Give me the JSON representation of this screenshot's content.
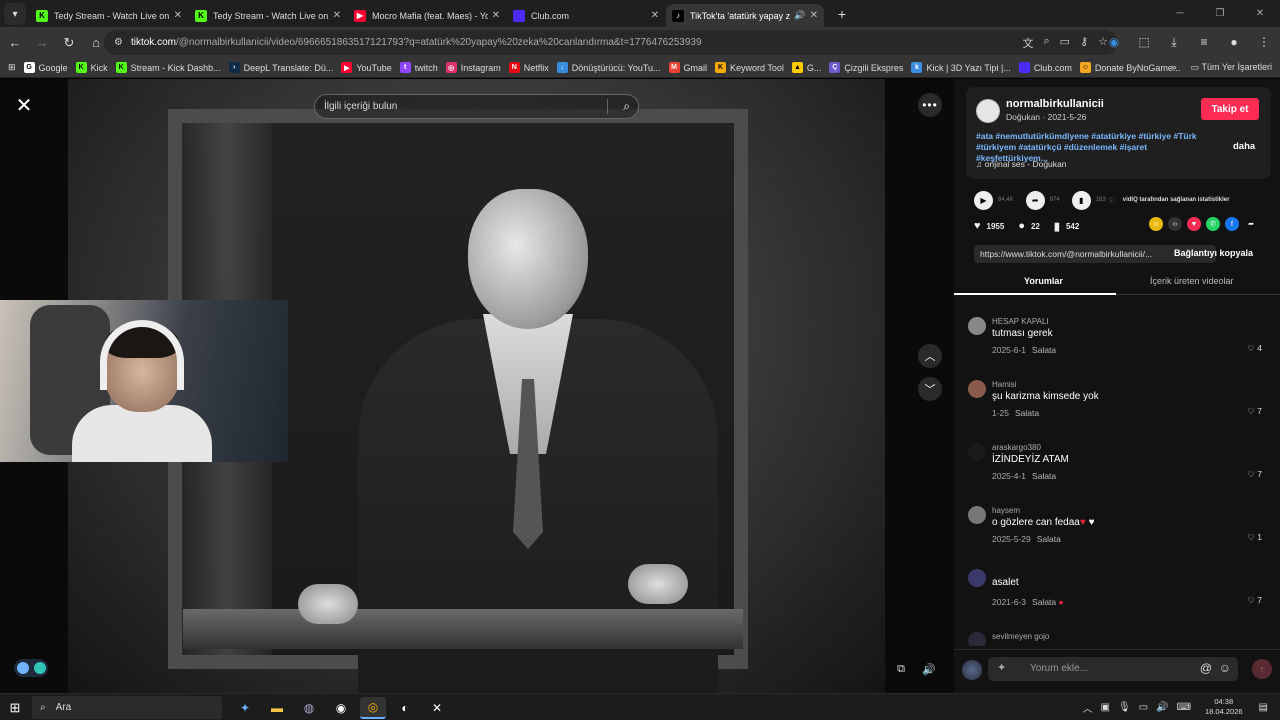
{
  "browser": {
    "tabs": [
      {
        "title": "Tedy Stream - Watch Live on Ki...",
        "favicon": "kick-icon",
        "color": "#53fc18"
      },
      {
        "title": "Tedy Stream - Watch Live on Ki...",
        "favicon": "kick-icon",
        "color": "#53fc18"
      },
      {
        "title": "Mocro Mafia (feat. Maes) - You...",
        "favicon": "youtube-icon",
        "color": "#ff0033"
      },
      {
        "title": "Club.com",
        "favicon": "club-icon",
        "color": "#4a2cff"
      },
      {
        "title": "TikTok'ta 'atatürk yapay zek...",
        "favicon": "tiktok-icon",
        "color": "#ffffff"
      }
    ],
    "url_host": "tiktok.com",
    "url_path": "/@normalbirkullanicii/video/6966651863517121793?q=atatürk%20yapay%20zeka%20canlandırma&t=1776476253939",
    "bookmarks": [
      {
        "label": "Google",
        "color": "#ffffff"
      },
      {
        "label": "Kick",
        "color": "#53fc18"
      },
      {
        "label": "Stream - Kick Dashb...",
        "color": "#53fc18"
      },
      {
        "label": "DeepL Translate: Dü...",
        "color": "#0f2b46"
      },
      {
        "label": "YouTube",
        "color": "#ff0033"
      },
      {
        "label": "twitch",
        "color": "#9146ff"
      },
      {
        "label": "Instagram",
        "color": "#e1306c"
      },
      {
        "label": "Netflix",
        "color": "#e50914"
      },
      {
        "label": "Dönüştürücü: YouTu...",
        "color": "#3a8dde"
      },
      {
        "label": "Gmail",
        "color": "#ea4335"
      },
      {
        "label": "Keyword Tool",
        "color": "#f2a900"
      },
      {
        "label": "G...",
        "color": "#ffcc00"
      },
      {
        "label": "Çizgili Ekspres",
        "color": "#6a5acd"
      },
      {
        "label": "Kick | 3D Yazı Tipi |...",
        "color": "#3a8dde"
      },
      {
        "label": "Club.com",
        "color": "#4a2cff"
      },
      {
        "label": "Donate ByNoGame...",
        "color": "#f5a623"
      }
    ],
    "bookmarks_overflow": "»",
    "all_bookmarks": "Tüm Yer İşaretleri"
  },
  "video": {
    "search_placeholder": "İlgili içeriği bulun"
  },
  "post": {
    "author": "normalbirkullanicii",
    "author_display": "Doğukan",
    "date": "2021-5-26",
    "follow_label": "Takip et",
    "hashtags": "#ata #nemutlutürkümdiyene #atatürkiye #türkiye #Türk #türkiyem #atatürkçü #düzenlemek #işaret #keşfettürkiyem...",
    "more_label": "daha",
    "music": "orijinal ses - Doğukan",
    "stats": {
      "plays": "84,4K",
      "shares": "974",
      "extra": "163"
    },
    "vidiq_label": "vidIQ tarafından sağlanan istatistikler",
    "likes": "1955",
    "comments": "22",
    "saves": "542",
    "link": "https://www.tiktok.com/@normalbirkullanicii/...",
    "copy_label": "Bağlantıyı kopyala"
  },
  "panel_tabs": {
    "comments": "Yorumlar",
    "creator_videos": "İçerik üreten videolar"
  },
  "comments": [
    {
      "user": "HESAP KAPALI",
      "text": "tutması gerek",
      "date": "2025-6-1",
      "reply": "Salata",
      "likes": "4"
    },
    {
      "user": "Hamisi",
      "text": "şu karizma kimsede yok",
      "date": "1-25",
      "reply": "Salata",
      "likes": "7"
    },
    {
      "user": "araskargo380",
      "text": "İZİNDEYİZ ATAM",
      "date": "2025-4-1",
      "reply": "Salata",
      "likes": "7"
    },
    {
      "user": "haysem",
      "text": "o gözlere can fedaa",
      "date": "2025-5-29",
      "reply": "Salata",
      "likes": "1"
    },
    {
      "user": "",
      "text": "asalet",
      "date": "2021-6-3",
      "reply": "Salata",
      "likes": "7"
    },
    {
      "user": "sevilmeyen gojo",
      "text": "",
      "date": "",
      "reply": "",
      "likes": ""
    }
  ],
  "comment_input": {
    "placeholder": "Yorum ekle..."
  },
  "taskbar": {
    "search_label": "Ara",
    "time": "04:38",
    "date": "18.04.2026"
  }
}
